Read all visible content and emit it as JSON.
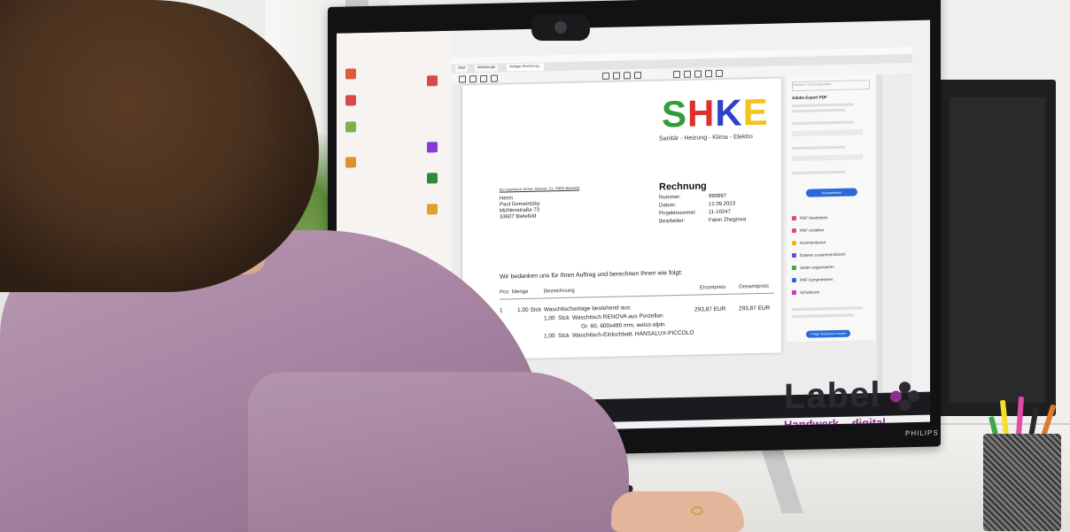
{
  "scene": {
    "description_free": true
  },
  "monitor": {
    "brand": "PHILIPS"
  },
  "browser": {
    "tabs": [
      "Start",
      "Werkzeuge",
      "Vorlage Rechnung..."
    ]
  },
  "invoice": {
    "logo_letters": [
      {
        "char": "S",
        "color": "#2e9e3a"
      },
      {
        "char": "H",
        "color": "#e02e2e"
      },
      {
        "char": "K",
        "color": "#2f3fc9"
      },
      {
        "char": "E",
        "color": "#f2c31a"
      }
    ],
    "logo_sub": "Sanitär - Heizung - Klima - Elektro",
    "sender_line": "Bei Handwerk GmbH, Mittelstr. 31, 33605 Bielefeld",
    "address": [
      "Herrn",
      "Paul Gemeintzky",
      "Mühlenstraße 73",
      "33607 Bielefeld"
    ],
    "title": "Rechnung",
    "meta_labels": [
      "Nummer:",
      "Datum:",
      "Projektnummer:",
      "Bearbeiter:"
    ],
    "meta_values": [
      "990997",
      "12.09.2023",
      "11-10247",
      "Faton Zhegrova"
    ],
    "intro": "Wir bedanken uns für Ihren Auftrag und berechnen Ihnen wie folgt:",
    "headers": {
      "pos": "Pos",
      "menge": "Menge",
      "bezeichnung": "Bezeichnung",
      "einzelpreis": "Einzelpreis",
      "gesamtpreis": "Gesamtpreis"
    },
    "rows": [
      {
        "pos": "1",
        "qty": "1,00 Stck",
        "text": "Waschtischanlage bestehend aus:",
        "unit": "293,87 EUR",
        "total": "293,87 EUR"
      },
      {
        "qty": "1,00",
        "unit_label": "Stck",
        "text": "Waschtisch RENOVA aus Porzellan"
      },
      {
        "text": "Gr. 60, 600x480 mm, weiss-alpin"
      },
      {
        "qty": "1,00",
        "unit_label": "Stck",
        "text": "Waschtisch-Einlochbatt. HANSALUX-PICCOLO"
      }
    ]
  },
  "right_panel": {
    "search": "Suchen: Text bearbeiten",
    "heading": "Adobe Export PDF",
    "convert_button": "Konvertieren",
    "tools": [
      {
        "label": "PDF bearbeiten",
        "color": "#e0457b"
      },
      {
        "label": "PDF erstellen",
        "color": "#e0457b"
      },
      {
        "label": "Kommentieren",
        "color": "#f2b21a"
      },
      {
        "label": "Dateien zusammenführen",
        "color": "#6a4ce0"
      },
      {
        "label": "Seiten organisieren",
        "color": "#3da84a"
      },
      {
        "label": "PDF komprimieren",
        "color": "#2a6ad8"
      },
      {
        "label": "Schwärzen",
        "color": "#c43ac4"
      }
    ],
    "trial_button": "7-Tage-Testversion starten"
  },
  "badge": {
    "word": "Label",
    "sub": "Handwerk – digital",
    "dot_colors": [
      "#8a2f8a",
      "#2a2a30",
      "#2a2a30",
      "#2a2a30"
    ]
  }
}
